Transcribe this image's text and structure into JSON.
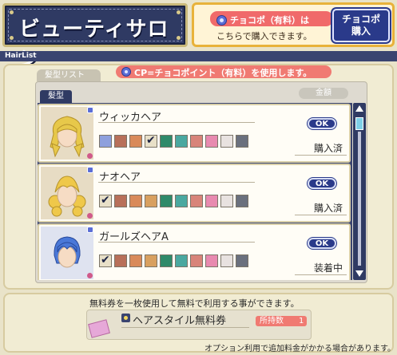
{
  "title": "ビューティサロン",
  "promo": {
    "line1": "チョコポ（有料）は",
    "line2": "こちらで購入できます。",
    "button": "チョコポ\n購入"
  },
  "window_title": "HairList",
  "tab_label": "髪型リスト",
  "cp_note": "CP=チョコポイント（有料）を使用します。",
  "category_tab": "髪型",
  "price_header": "金額",
  "items": [
    {
      "name": "ウィッカヘア",
      "ok": "OK",
      "status": "購入済",
      "hair_color": "#e7c84a",
      "swatches": [
        "#8ea0dd",
        "#b8705a",
        "#d98a5a",
        "#e8e0c8",
        "#2f8a6a",
        "#4aa8a0",
        "#d8847a",
        "#e88ab0",
        "#e8e2e0",
        "#6a707e"
      ],
      "checked": 3
    },
    {
      "name": "ナオヘア",
      "ok": "OK",
      "status": "購入済",
      "hair_color": "#efc84a",
      "swatches": [
        "#e8e0c8",
        "#b8705a",
        "#d98a5a",
        "#d8a060",
        "#2f8a6a",
        "#4aa8a0",
        "#d8847a",
        "#e88ab0",
        "#e8e2e0",
        "#6a707e"
      ],
      "checked": 0
    },
    {
      "name": "ガールズヘアA",
      "ok": "OK",
      "status": "装着中",
      "hair_color": "#4a78d8",
      "swatches": [
        "#e8e0c8",
        "#b8705a",
        "#d98a5a",
        "#d8a060",
        "#2f8a6a",
        "#4aa8a0",
        "#d8847a",
        "#e88ab0",
        "#e8e2e0",
        "#6a707e"
      ],
      "checked": 0
    }
  ],
  "footer": {
    "text": "無料券を一枚使用して無料で利用する事ができます。",
    "ticket_name": "ヘアスタイル無料券",
    "own_label": "所持数",
    "own_count": "1",
    "note": "オプション利用で追加料金がかかる場合があります。"
  }
}
